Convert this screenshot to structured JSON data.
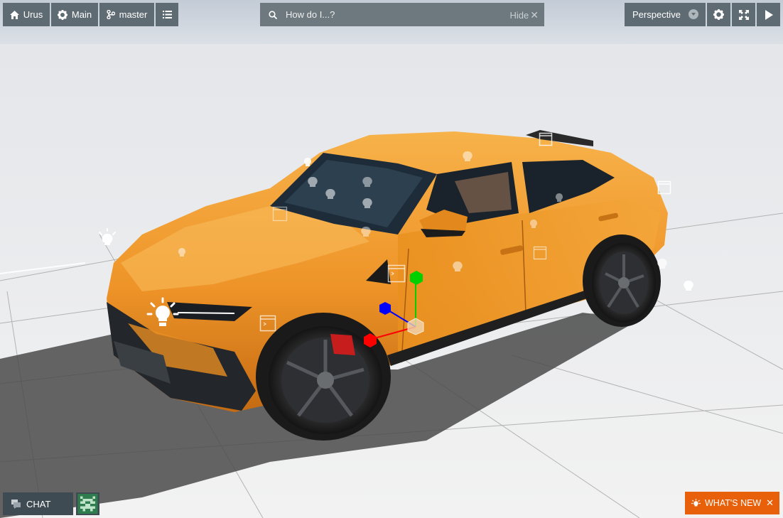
{
  "toolbar": {
    "project_label": "Urus",
    "scene_label": "Main",
    "branch_label": "master"
  },
  "search": {
    "placeholder": "How do I...?",
    "hide_label": "Hide"
  },
  "camera": {
    "selected": "Perspective"
  },
  "bottom": {
    "chat_label": "CHAT",
    "whats_new_label": "WHAT'S NEW"
  },
  "icons": {
    "home": "home-icon",
    "settings": "gear-icon",
    "branch": "branch-icon",
    "list": "list-icon",
    "search": "search-icon",
    "close": "close-icon",
    "fullscreen": "fullscreen-icon",
    "play": "play-icon",
    "chat": "chat-icon",
    "bulb": "lightbulb-icon",
    "script": "script-icon"
  },
  "colors": {
    "toolbar_bg": "#5f6b73",
    "search_bg": "#6d787f",
    "whats_new_bg": "#e8600a",
    "car_body": "#f09a2c",
    "gizmo_x": "#ff0000",
    "gizmo_y": "#00d000",
    "gizmo_z": "#0000ff"
  }
}
